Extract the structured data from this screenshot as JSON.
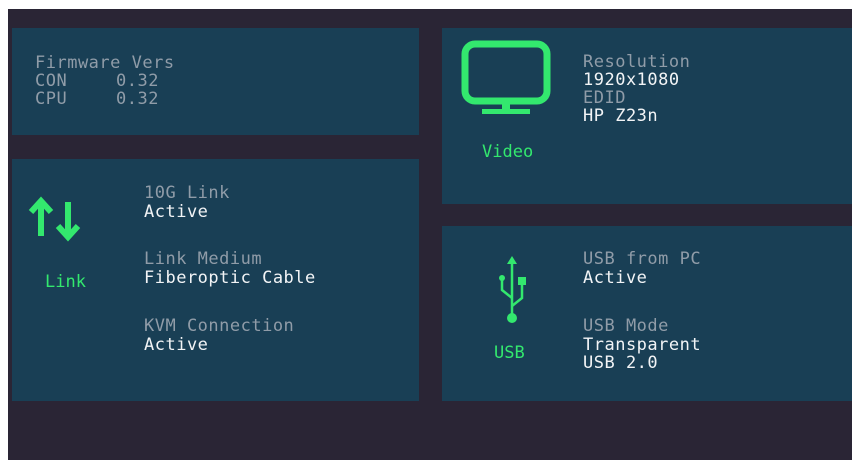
{
  "accent_color": "#33e86e",
  "firmware": {
    "title": "Firmware Vers",
    "rows": [
      {
        "name": "CON",
        "value": "0.32"
      },
      {
        "name": "CPU",
        "value": "0.32"
      }
    ]
  },
  "link": {
    "icon": "up-down-arrows-icon",
    "caption": "Link",
    "fields": [
      {
        "label": "10G Link",
        "value": "Active"
      },
      {
        "label": "Link Medium",
        "value": "Fiberoptic Cable"
      },
      {
        "label": "KVM Connection",
        "value": "Active"
      }
    ]
  },
  "video": {
    "icon": "monitor-icon",
    "caption": "Video",
    "fields": [
      {
        "label": "Resolution",
        "value": "1920x1080"
      },
      {
        "label": "EDID",
        "value": "HP Z23n"
      }
    ]
  },
  "usb": {
    "icon": "usb-icon",
    "caption": "USB",
    "fields": [
      {
        "label": "USB from PC",
        "value": "Active"
      },
      {
        "label": "USB Mode",
        "value": "Transparent\nUSB 2.0"
      }
    ]
  }
}
